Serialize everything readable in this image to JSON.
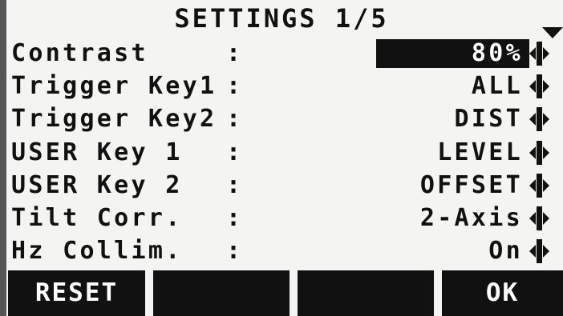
{
  "title": "SETTINGS 1/5",
  "icons": {
    "scroll": "scroll-down-triangle",
    "toggle": "left-right-toggle"
  },
  "rows": [
    {
      "label": "Contrast",
      "value": "80%",
      "selected": true
    },
    {
      "label": "Trigger Key1",
      "value": "ALL",
      "selected": false
    },
    {
      "label": "Trigger Key2",
      "value": "DIST",
      "selected": false
    },
    {
      "label": "USER Key 1",
      "value": "LEVEL",
      "selected": false
    },
    {
      "label": "USER Key 2",
      "value": "OFFSET",
      "selected": false
    },
    {
      "label": "Tilt Corr.",
      "value": "2-Axis",
      "selected": false
    },
    {
      "label": "Hz Collim.",
      "value": "On",
      "selected": false
    }
  ],
  "separator": ":",
  "softkeys": [
    "RESET",
    "",
    "",
    "OK"
  ],
  "colors": {
    "background": "#f4f4f2",
    "foreground": "#111111",
    "highlight": "#111111",
    "highlight_text": "#ffffff"
  }
}
